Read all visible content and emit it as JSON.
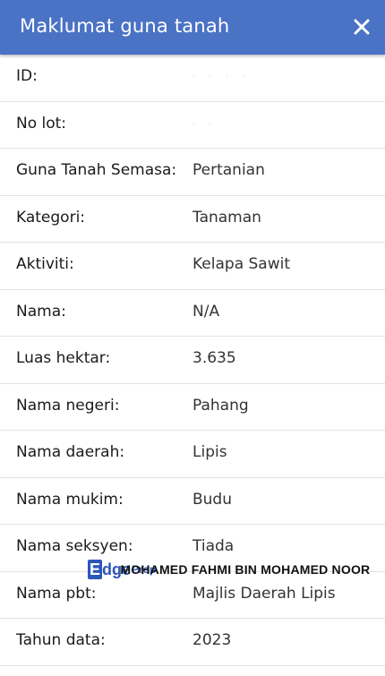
{
  "header": {
    "title": "Maklumat guna tanah",
    "close_label": "×"
  },
  "rows": [
    {
      "label": "ID:",
      "value": "· · · ·"
    },
    {
      "label": "No lot:",
      "value": "· ·"
    },
    {
      "label": "Guna Tanah Semasa:",
      "value": "Pertanian"
    },
    {
      "label": "Kategori:",
      "value": "Tanaman"
    },
    {
      "label": "Aktiviti:",
      "value": "Kelapa Sawit"
    },
    {
      "label": "Nama:",
      "value": "N/A"
    },
    {
      "label": "Luas hektar:",
      "value": "3.635"
    },
    {
      "label": "Nama negeri:",
      "value": "Pahang"
    },
    {
      "label": "Nama daerah:",
      "value": "Lipis"
    },
    {
      "label": "Nama mukim:",
      "value": "Budu"
    },
    {
      "label": "Nama seksyen:",
      "value": "Tiada"
    },
    {
      "label": "Nama pbt:",
      "value": "Majlis Daerah Lipis"
    },
    {
      "label": "Tahun data:",
      "value": "2023"
    }
  ],
  "watermark": {
    "logo_e": "E",
    "logo_dge": "dge",
    "logo_prop": "Prop",
    "name": "MOHAMED FAHMI BIN MOHAMED NOOR"
  },
  "colors": {
    "header_bg": "#4a72c5",
    "header_text": "#ffffff",
    "divider": "#e3e3e3",
    "watermark_brand": "#2c57b8"
  }
}
